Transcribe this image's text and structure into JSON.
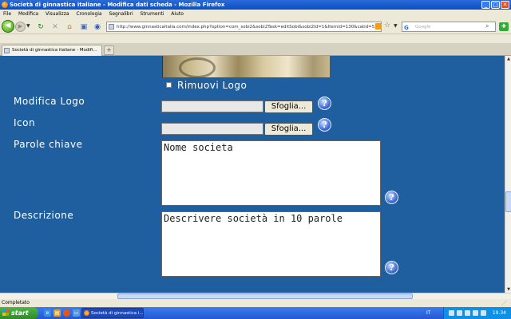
{
  "window": {
    "title": "Società di ginnastica italiane - Modifica dati scheda - Mozilla Firefox",
    "buttons": [
      "_",
      "□",
      "✕"
    ]
  },
  "menu": [
    "File",
    "Modifica",
    "Visualizza",
    "Cronologia",
    "Segnalibri",
    "Strumenti",
    "Aiuto"
  ],
  "navbar": {
    "url": "http://www.ginnasticaitalia.com/index.php?option=com_sobi2&sobi2Task=editSobi&sobi2Id=1&Itemid=130&catid=527",
    "search_placeholder": "Google",
    "search_engine_glyph": "G"
  },
  "tabs": [
    {
      "label": "Società di ginnastica italiane - Modifi..."
    }
  ],
  "form": {
    "remove_logo_label": "Rimuovi Logo",
    "modify_logo_label": "Modifica Logo",
    "icon_label": "Icon",
    "keywords_label": "Parole chiave",
    "description_label": "Descrizione",
    "browse_label": "Sfoglia...",
    "help_glyph": "?",
    "keywords_value": "Nome societa",
    "description_value": "Descrivere società in 10 parole"
  },
  "status": {
    "text": "Completato"
  },
  "taskbar": {
    "start_label": "start",
    "task_item": "Società di ginnastica i...",
    "lang": "IT",
    "clock": "19.34"
  },
  "colors": {
    "page_background": "#1f5fa0",
    "titlebar": "#0a4fc4",
    "chrome": "#ece9d8"
  }
}
